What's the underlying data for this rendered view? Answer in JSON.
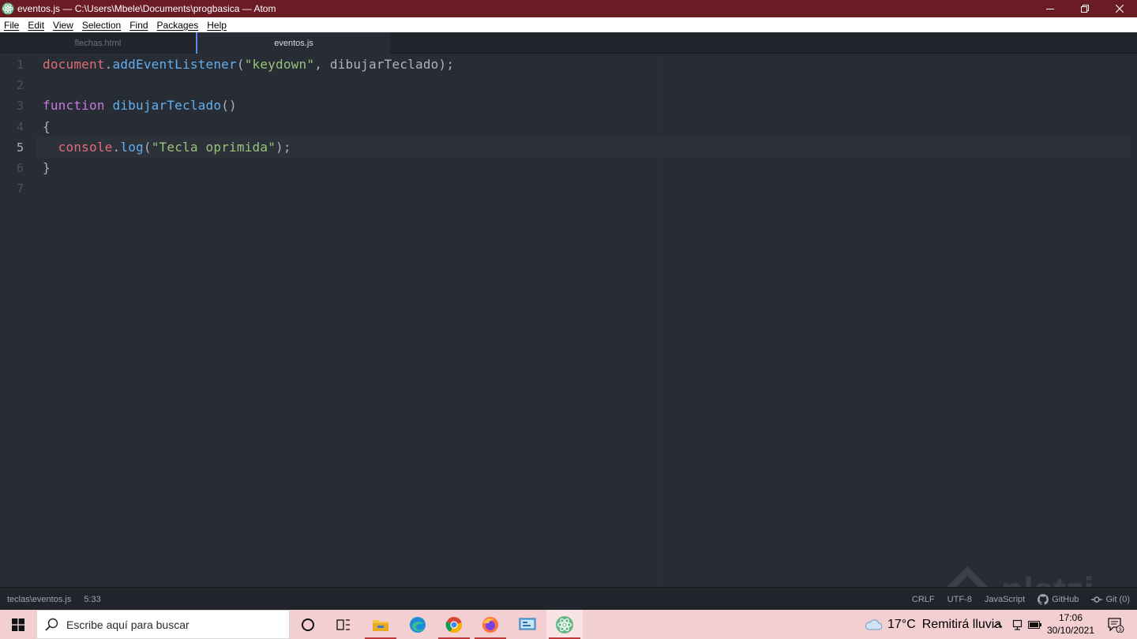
{
  "window": {
    "title": "eventos.js — C:\\Users\\Mbele\\Documents\\progbasica — Atom"
  },
  "menu": [
    "File",
    "Edit",
    "View",
    "Selection",
    "Find",
    "Packages",
    "Help"
  ],
  "tabs": [
    {
      "label": "flechas.html",
      "active": false
    },
    {
      "label": "eventos.js",
      "active": true
    }
  ],
  "editor": {
    "current_line": 5,
    "line_numbers": [
      "1",
      "2",
      "3",
      "4",
      "5",
      "6",
      "7"
    ],
    "lines": [
      {
        "indent": "",
        "tokens": [
          {
            "t": "document",
            "c": "obj"
          },
          {
            "t": ".",
            "c": "pl"
          },
          {
            "t": "addEventListener",
            "c": "fn"
          },
          {
            "t": "(",
            "c": "pl"
          },
          {
            "t": "\"keydown\"",
            "c": "str"
          },
          {
            "t": ", dibujarTeclado);",
            "c": "pl"
          }
        ]
      },
      {
        "indent": "",
        "tokens": []
      },
      {
        "indent": "",
        "tokens": [
          {
            "t": "function",
            "c": "kw"
          },
          {
            "t": " ",
            "c": "pl"
          },
          {
            "t": "dibujarTeclado",
            "c": "fn"
          },
          {
            "t": "()",
            "c": "pl"
          }
        ]
      },
      {
        "indent": "",
        "tokens": [
          {
            "t": "{",
            "c": "pl"
          }
        ]
      },
      {
        "indent": "  ",
        "tokens": [
          {
            "t": "console",
            "c": "obj"
          },
          {
            "t": ".",
            "c": "pl"
          },
          {
            "t": "log",
            "c": "fn"
          },
          {
            "t": "(",
            "c": "pl"
          },
          {
            "t": "\"Tecla oprimida\"",
            "c": "str"
          },
          {
            "t": ");",
            "c": "pl"
          }
        ]
      },
      {
        "indent": "",
        "tokens": [
          {
            "t": "}",
            "c": "pl"
          }
        ]
      },
      {
        "indent": "",
        "tokens": []
      }
    ]
  },
  "status": {
    "file_path": "teclas\\eventos.js",
    "cursor_position": "5:33",
    "line_ending": "CRLF",
    "encoding": "UTF-8",
    "grammar": "JavaScript",
    "github_label": "GitHub",
    "git_label": "Git (0)"
  },
  "taskbar": {
    "search_placeholder": "Escribe aquí para buscar",
    "apps": [
      "cortana-icon",
      "task-view-icon",
      "file-explorer-icon",
      "edge-icon",
      "chrome-icon",
      "firefox-icon",
      "control-panel-icon",
      "atom-icon"
    ],
    "weather_temp": "17°C",
    "weather_text": "Remitirá lluvia",
    "time": "17:06",
    "date": "30/10/2021",
    "notification_count": "3"
  },
  "colors": {
    "titlebar": "#6b1b23",
    "editor_bg": "#282c34",
    "accent": "#568af2",
    "taskbar": "#f3cfd2"
  }
}
